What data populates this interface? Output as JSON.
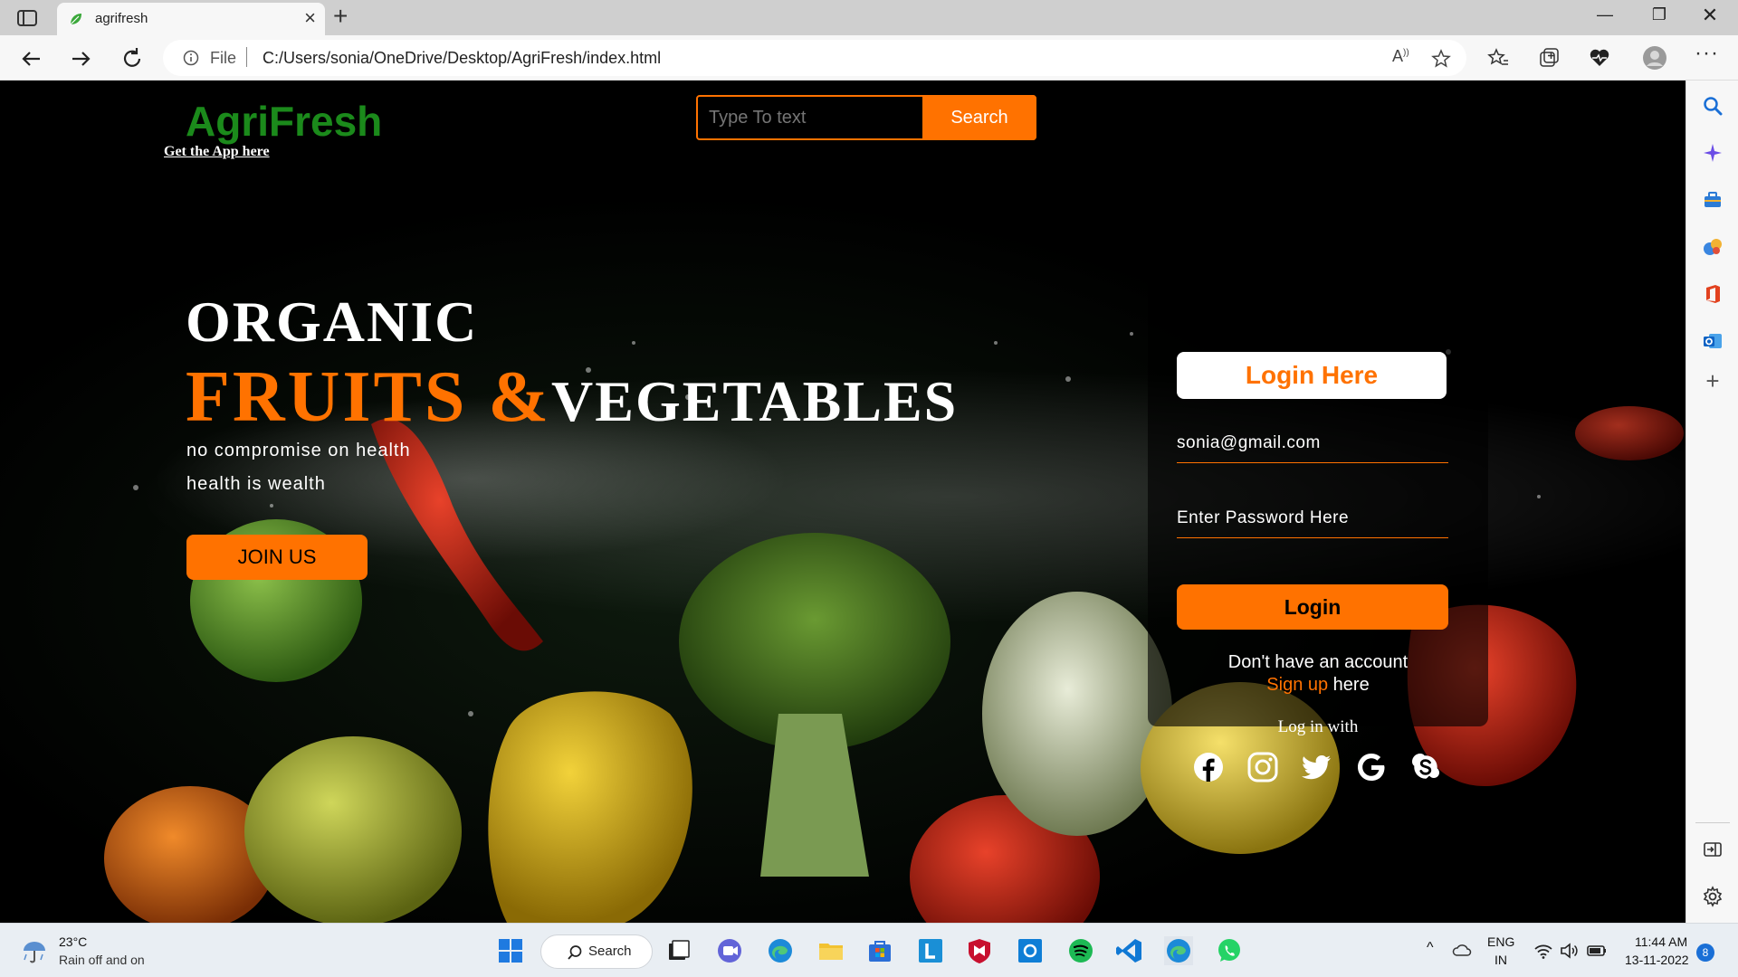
{
  "browser": {
    "tab_title": "agrifresh",
    "file_label": "File",
    "url": "C:/Users/sonia/OneDrive/Desktop/AgriFresh/index.html"
  },
  "site": {
    "logo": "AgriFresh",
    "app_link": "Get the App here",
    "search": {
      "placeholder": "Type To text",
      "button": "Search"
    },
    "hero": {
      "line1": "ORGANIC",
      "line2_accent": "FRUITS &",
      "line2_rest": "VEGETABLES",
      "tagline1": "no compromise on health",
      "tagline2": "health is wealth",
      "cta": "JOIN US"
    },
    "login": {
      "title": "Login Here",
      "email_value": "sonia@gmail.com",
      "password_placeholder": "Enter Password Here",
      "button": "Login",
      "no_account": "Don't have an account",
      "signup_link": "Sign up",
      "signup_suffix": " here",
      "login_with": "Log in with",
      "socials": [
        "facebook-icon",
        "instagram-icon",
        "twitter-icon",
        "google-icon",
        "skype-icon"
      ]
    },
    "colors": {
      "accent": "#ff7200",
      "logo": "#1b8a1b"
    }
  },
  "taskbar": {
    "weather_temp": "23°C",
    "weather_desc": "Rain off and on",
    "search_label": "Search",
    "lang_top": "ENG",
    "lang_bottom": "IN",
    "time": "11:44 AM",
    "date": "13-11-2022",
    "notifications": "8"
  }
}
